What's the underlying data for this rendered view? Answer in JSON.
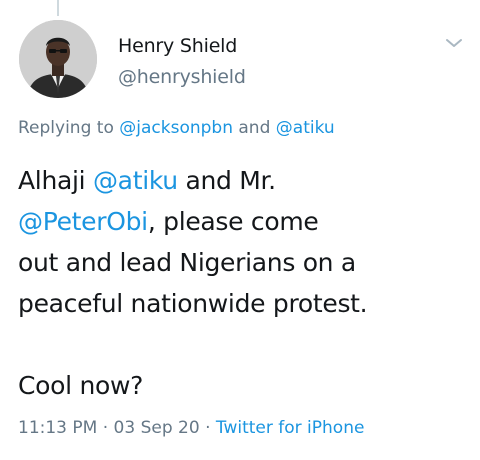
{
  "author": {
    "name": "Henry Shield",
    "handle": "@henryshield"
  },
  "reply": {
    "prefix": "Replying to",
    "user1": "@jacksonpbn",
    "conj": "and",
    "user2": "@atiku"
  },
  "tweet": {
    "l1_a": "Alhaji",
    "l1_mention": "@atiku",
    "l1_b": "and Mr.",
    "l2_mention": "@PeterObi",
    "l2_b": ", please come",
    "l3": "out and lead Nigerians on a",
    "l4": "peaceful nationwide protest.",
    "l5": "Cool now?"
  },
  "meta": {
    "time": "11:13 PM",
    "sep1": "·",
    "date": "03 Sep 20",
    "sep2": "·",
    "source": "Twitter for iPhone"
  },
  "colors": {
    "link": "#1b95e0",
    "muted": "#657786",
    "text": "#14171a"
  },
  "icons": {
    "more": "chevron-down-icon"
  }
}
